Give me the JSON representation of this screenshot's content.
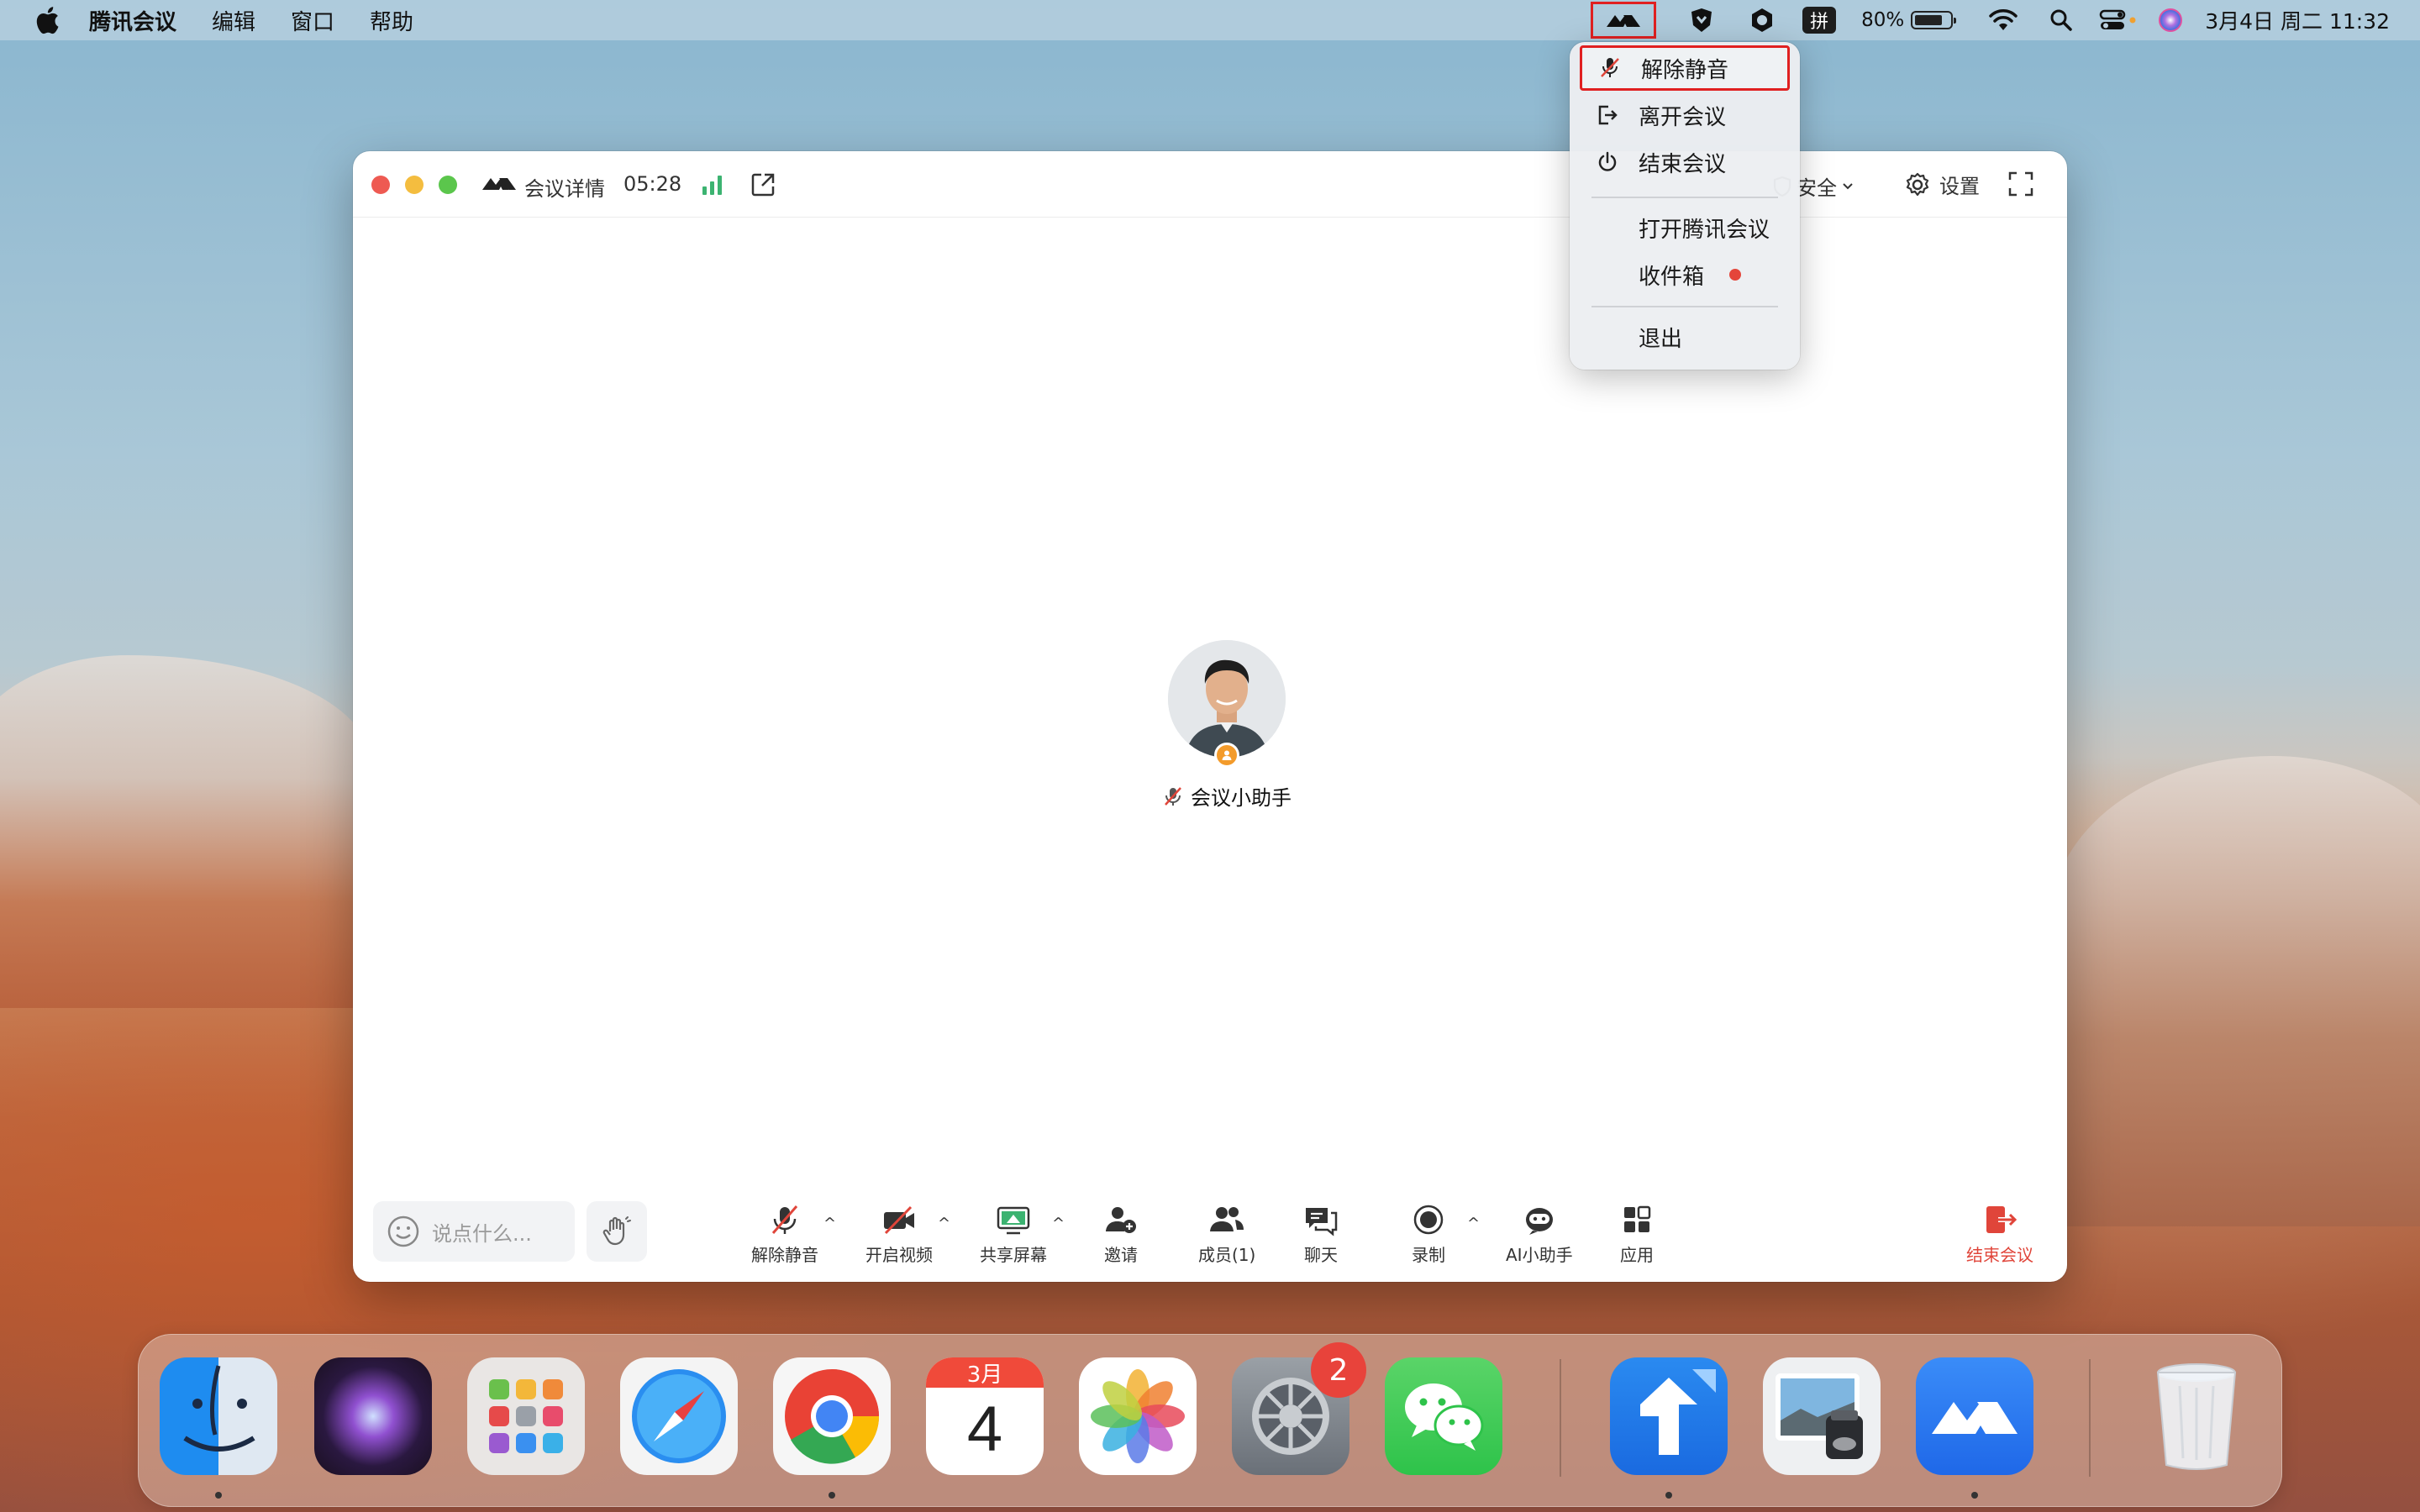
{
  "menubar": {
    "app_name": "腾讯会议",
    "menus": [
      "编辑",
      "窗口",
      "帮助"
    ],
    "ime_label": "拼",
    "battery_percent": "80%",
    "battery_level": 0.8,
    "datetime": "3月4日 周二 11:32"
  },
  "tray_menu": {
    "items": [
      {
        "label": "解除静音",
        "icon": "mic-muted-icon"
      },
      {
        "label": "离开会议",
        "icon": "leave-icon"
      },
      {
        "label": "结束会议",
        "icon": "power-icon"
      },
      {
        "label": "打开腾讯会议"
      },
      {
        "label": "收件箱",
        "has_dot": true
      },
      {
        "label": "退出"
      }
    ]
  },
  "window": {
    "detail_label": "会议详情",
    "timer": "05:28",
    "security_label": "安全",
    "settings_label": "设置"
  },
  "participant": {
    "name": "会议小助手"
  },
  "toolbar": {
    "chat_placeholder": "说点什么...",
    "buttons": [
      {
        "label": "解除静音"
      },
      {
        "label": "开启视频"
      },
      {
        "label": "共享屏幕"
      },
      {
        "label": "邀请"
      },
      {
        "label": "成员(1)"
      },
      {
        "label": "聊天"
      },
      {
        "label": "录制"
      },
      {
        "label": "AI小助手"
      },
      {
        "label": "应用"
      },
      {
        "label": "结束会议"
      }
    ]
  },
  "dock": {
    "calendar_month": "3月",
    "calendar_day": "4",
    "settings_badge": "2",
    "apps": [
      "Finder",
      "Siri",
      "Launchpad",
      "Safari",
      "Chrome",
      "Calendar",
      "Photos",
      "System Settings",
      "WeChat",
      "Maps-like",
      "Preview",
      "Tencent Meeting",
      "Trash"
    ]
  },
  "colors": {
    "accent_red": "#e02020",
    "end_meeting": "#e0453a",
    "signal_green": "#3cb371"
  }
}
